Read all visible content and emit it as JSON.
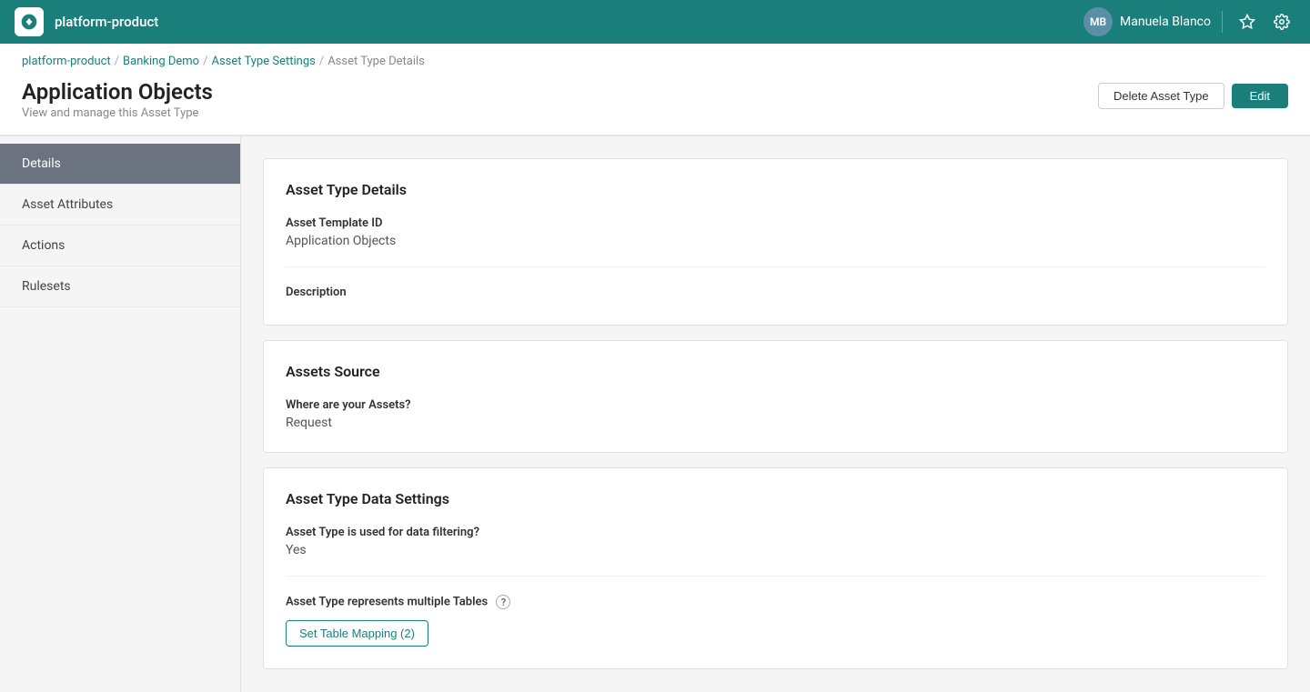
{
  "topnav": {
    "product_name": "platform-product",
    "user_initials": "MB",
    "user_name": "Manuela Blanco"
  },
  "breadcrumb": {
    "items": [
      {
        "label": "platform-product",
        "href": "#"
      },
      {
        "label": "Banking Demo",
        "href": "#"
      },
      {
        "label": "Asset Type Settings",
        "href": "#"
      },
      {
        "label": "Asset Type Details",
        "href": null
      }
    ]
  },
  "page": {
    "title": "Application Objects",
    "subtitle": "View and manage this Asset Type",
    "btn_delete": "Delete Asset Type",
    "btn_edit": "Edit"
  },
  "sidebar": {
    "items": [
      {
        "label": "Details",
        "active": true
      },
      {
        "label": "Asset Attributes",
        "active": false
      },
      {
        "label": "Actions",
        "active": false
      },
      {
        "label": "Rulesets",
        "active": false
      }
    ]
  },
  "cards": {
    "details": {
      "title": "Asset Type Details",
      "template_id_label": "Asset Template ID",
      "template_id_value": "Application Objects",
      "description_label": "Description"
    },
    "assets_source": {
      "title": "Assets Source",
      "where_label": "Where are your Assets?",
      "where_value": "Request"
    },
    "data_settings": {
      "title": "Asset Type Data Settings",
      "filtering_label": "Asset Type is used for data filtering?",
      "filtering_value": "Yes",
      "multiple_tables_label": "Asset Type represents multiple Tables",
      "multiple_tables_tooltip": "?",
      "mapping_btn": "Set Table Mapping (2)"
    }
  }
}
